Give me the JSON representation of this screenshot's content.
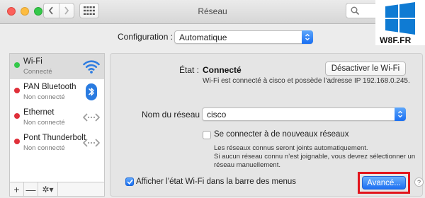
{
  "window": {
    "title": "Réseau"
  },
  "watermark": {
    "text": "W8F.FR"
  },
  "configuration": {
    "label": "Configuration :",
    "value": "Automatique"
  },
  "sidebar": {
    "items": [
      {
        "name": "Wi-Fi",
        "status": "Connecté",
        "dot_color": "#34c84a",
        "icon": "wifi-icon",
        "selected": true
      },
      {
        "name": "PAN Bluetooth",
        "status": "Non connecté",
        "dot_color": "#e0303a",
        "icon": "bluetooth-icon",
        "selected": false
      },
      {
        "name": "Ethernet",
        "status": "Non connecté",
        "dot_color": "#e0303a",
        "icon": "ethernet-arrows-icon",
        "selected": false
      },
      {
        "name": "Pont Thunderbolt",
        "status": "Non connecté",
        "dot_color": "#e0303a",
        "icon": "thunderbolt-arrows-icon",
        "selected": false
      }
    ],
    "toolbar": {
      "add": "+",
      "remove": "—",
      "actions": "✲▾"
    }
  },
  "detail": {
    "state_label": "État :",
    "state_value": "Connecté",
    "disable_button": "Désactiver le Wi-Fi",
    "connection_description": "Wi-Fi est connecté à cisco et possède l’adresse IP 192.168.0.245.",
    "network_name_label": "Nom du réseau :",
    "network_name_value": "cisco",
    "join_new_label": "Se connecter à de nouveaux réseaux",
    "join_new_note": [
      "Les réseaux connus seront joints automatiquement.",
      "Si aucun réseau connu n’est joignable, vous devrez sélectionner un",
      "réseau manuellement."
    ],
    "show_status_label": "Afficher l’état Wi-Fi dans la barre des menus",
    "show_status_checked": true,
    "advanced_button": "Avancé...",
    "help": "?"
  },
  "colors": {
    "accent": "#1a6ff2",
    "highlight_frame": "#e2141c"
  }
}
